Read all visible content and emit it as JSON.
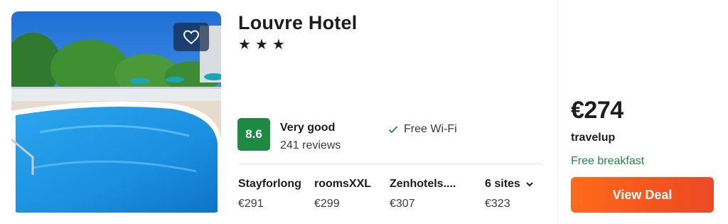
{
  "hotel": {
    "name": "Louvre Hotel",
    "stars": [
      "★",
      "★",
      "★"
    ],
    "rating": {
      "score": "8.6",
      "label": "Very good",
      "reviews": "241 reviews",
      "badge_color": "#1e8a41"
    },
    "amenity": {
      "icon": "check-icon",
      "label": "Free Wi-Fi"
    },
    "favorite_icon": "heart-icon"
  },
  "sites": [
    {
      "name": "Stayforlong",
      "price": "€291"
    },
    {
      "name": "roomsXXL",
      "price": "€299"
    },
    {
      "name": "Zenhotels....",
      "price": "€307"
    }
  ],
  "more_sites": {
    "label": "6 sites",
    "price": "€323",
    "icon": "chevron-down-icon"
  },
  "deal": {
    "price": "€274",
    "provider": "travelup",
    "perk": "Free breakfast",
    "button_label": "View Deal",
    "button_color": "#f5561d",
    "perk_color": "#1e8a41"
  }
}
